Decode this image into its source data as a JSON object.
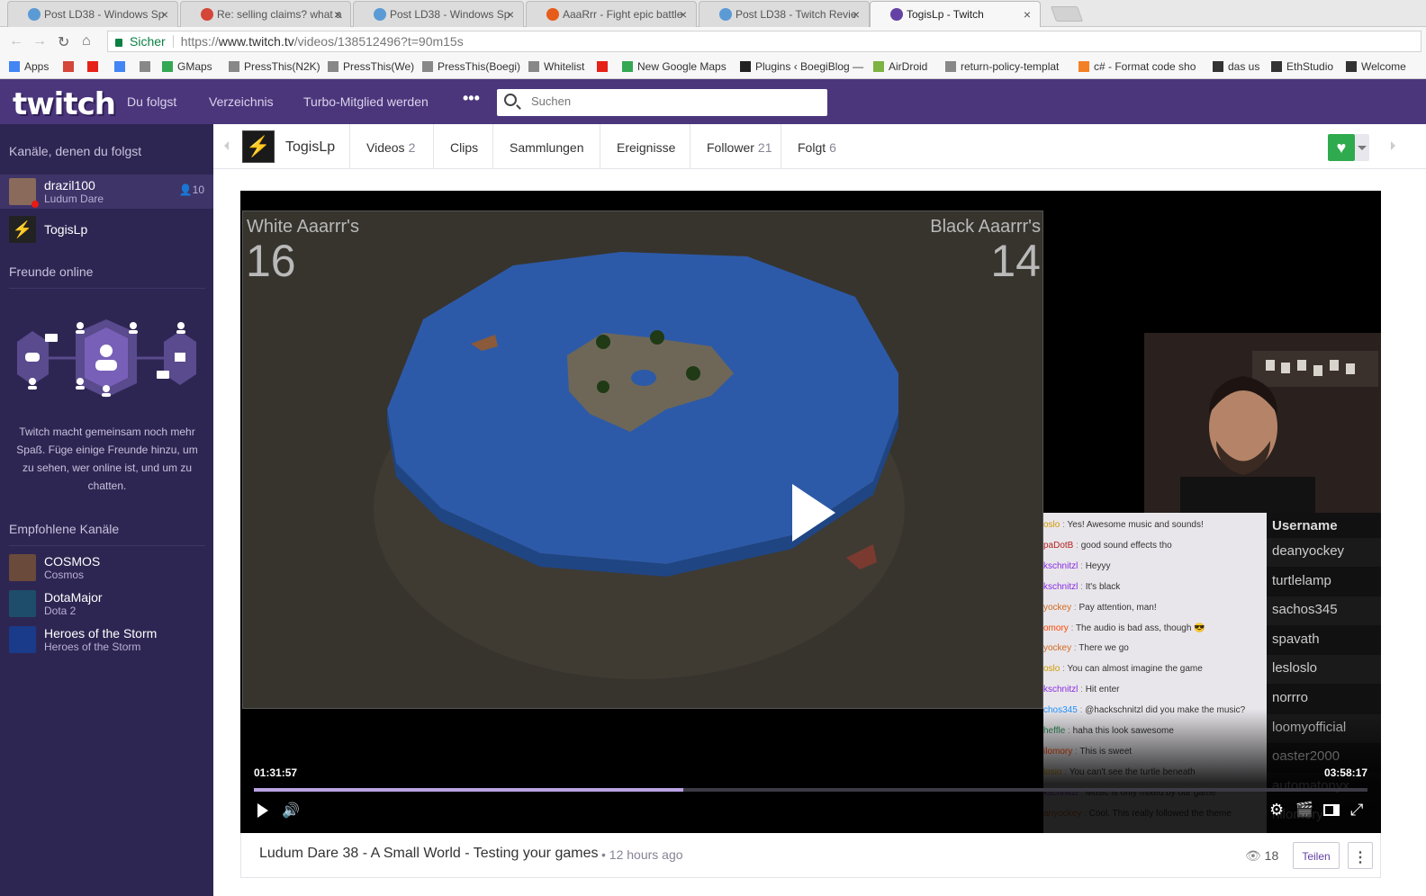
{
  "tabs": [
    {
      "title": "Post LD38 - Windows Sp",
      "active": false,
      "color": "#5b9bd5"
    },
    {
      "title": "Re: selling claims? what a",
      "active": false,
      "color": "#d44638"
    },
    {
      "title": "Post LD38 - Windows Sp",
      "active": false,
      "color": "#5b9bd5"
    },
    {
      "title": "AaaRrr - Fight epic battle",
      "active": false,
      "color": "#e65c1a"
    },
    {
      "title": "Post LD38 - Twitch Revie",
      "active": false,
      "color": "#5b9bd5"
    },
    {
      "title": "TogisLp - Twitch",
      "active": true,
      "color": "#6441a4"
    }
  ],
  "address": {
    "secure_label": "Sicher",
    "url_prefix": "https://",
    "url_host": "www.twitch.tv",
    "url_path": "/videos/138512496?t=90m15s"
  },
  "bookmarks": [
    {
      "label": "Apps",
      "icon": "apps-icon",
      "color": "#4285f4"
    },
    {
      "label": "",
      "icon": "gmail-icon",
      "color": "#d44638"
    },
    {
      "label": "",
      "icon": "youtube-icon",
      "color": "#e62117"
    },
    {
      "label": "",
      "icon": "google-icon",
      "color": "#4285f4"
    },
    {
      "label": "",
      "icon": "page-icon",
      "color": "#888888"
    },
    {
      "label": "GMaps",
      "icon": "maps-icon",
      "color": "#34a853"
    },
    {
      "label": "PressThis(N2K)",
      "icon": "page-icon",
      "color": "#888888"
    },
    {
      "label": "PressThis(We)",
      "icon": "page-icon",
      "color": "#888888"
    },
    {
      "label": "PressThis(Boegi)",
      "icon": "page-icon",
      "color": "#888888"
    },
    {
      "label": "Whitelist",
      "icon": "page-icon",
      "color": "#888888"
    },
    {
      "label": "",
      "icon": "youtube-icon",
      "color": "#e62117"
    },
    {
      "label": "New Google Maps",
      "icon": "maps-icon",
      "color": "#34a853"
    },
    {
      "label": "Plugins ‹ BoegiBlog —",
      "icon": "plugin-icon",
      "color": "#222222"
    },
    {
      "label": "AirDroid",
      "icon": "airdroid-icon",
      "color": "#7cb342"
    },
    {
      "label": "return-policy-templat",
      "icon": "page-icon",
      "color": "#888888"
    },
    {
      "label": "c# - Format code sho",
      "icon": "stackoverflow-icon",
      "color": "#f48024"
    },
    {
      "label": "das us",
      "icon": "headphones-icon",
      "color": "#333333"
    },
    {
      "label": "EthStudio",
      "icon": "ethstudio-icon",
      "color": "#333333"
    },
    {
      "label": "Welcome",
      "icon": "film-icon",
      "color": "#333333"
    }
  ],
  "topnav": {
    "logo": "twitch",
    "links": [
      "Du folgst",
      "Verzeichnis",
      "Turbo-Mitglied werden"
    ],
    "search_placeholder": "Suchen",
    "bg_color": "#4b367c"
  },
  "sidebar": {
    "followed_heading": "Kanäle, denen du folgst",
    "followed": [
      {
        "name": "drazil100",
        "game": "Ludum Dare",
        "viewers": "10",
        "active": true
      },
      {
        "name": "TogisLp",
        "game": "",
        "viewers": "",
        "active": false
      }
    ],
    "friends_heading": "Freunde online",
    "friends_text": "Twitch macht gemeinsam noch mehr Spaß. Füge einige Freunde hinzu, um zu sehen, wer online ist, und um zu chatten.",
    "recommended_heading": "Empfohlene Kanäle",
    "recommended": [
      {
        "name": "COSMOS",
        "game": "Cosmos"
      },
      {
        "name": "DotaMajor",
        "game": "Dota 2"
      },
      {
        "name": "Heroes of the Storm",
        "game": "Heroes of the Storm"
      }
    ]
  },
  "channelbar": {
    "name": "TogisLp",
    "tabs": [
      {
        "label": "Videos",
        "count": "2"
      },
      {
        "label": "Clips",
        "count": ""
      },
      {
        "label": "Sammlungen",
        "count": ""
      },
      {
        "label": "Ereignisse",
        "count": ""
      },
      {
        "label": "Follower",
        "count": "21"
      },
      {
        "label": "Folgt",
        "count": "6"
      }
    ],
    "follow_color": "#2faa4e"
  },
  "player": {
    "score_left_label": "White Aaarrr's",
    "score_left": "16",
    "score_right_label": "Black Aaarrr's",
    "score_right": "14",
    "current_time": "01:31:57",
    "duration": "03:58:17",
    "progress": 0.386,
    "chat": [
      {
        "user": "oslo",
        "color": "#d19a00",
        "msg": "Yes! Awesome music and sounds!"
      },
      {
        "user": "paDotB",
        "color": "#b22222",
        "msg": "good sound effects tho"
      },
      {
        "user": "kschnitzl",
        "color": "#8a2be2",
        "msg": "Heyyy"
      },
      {
        "user": "kschnitzl",
        "color": "#8a2be2",
        "msg": "It's black"
      },
      {
        "user": "yockey",
        "color": "#d2691e",
        "msg": "Pay attention, man!"
      },
      {
        "user": "omory",
        "color": "#ff4500",
        "msg": "The audio is bad ass, though 😎"
      },
      {
        "user": "yockey",
        "color": "#d2691e",
        "msg": "There we go"
      },
      {
        "user": "oslo",
        "color": "#d19a00",
        "msg": "You can almost imagine the game"
      },
      {
        "user": "kschnitzl",
        "color": "#8a2be2",
        "msg": "Hit enter"
      },
      {
        "user": "chos345",
        "color": "#1e90ff",
        "msg": "@hackschnitzl did you make the music?"
      },
      {
        "user": "heffle",
        "color": "#2e8b57",
        "msg": "haha this look sawesome"
      },
      {
        "user": "ilomory",
        "color": "#ff4500",
        "msg": "This is sweet"
      },
      {
        "user": "losio",
        "color": "#d19a00",
        "msg": "You can't see the turtle beneath"
      },
      {
        "user": "kschnitzl",
        "color": "#8a2be2",
        "msg": "Music is only mixed by our game"
      },
      {
        "user": "anyockey",
        "color": "#d2691e",
        "msg": "Cool. This really followed the theme"
      }
    ],
    "userlist_heading": "Username",
    "users": [
      "deanyockey",
      "turtlelamp",
      "sachos345",
      "spavath",
      "lesloslo",
      "norrro",
      "loomyofficial",
      "oaster2000",
      "automatonyx",
      "hilomory"
    ]
  },
  "video": {
    "title": "Ludum Dare 38 - A Small World - Testing your games",
    "ago": "• 12 hours ago",
    "views": "18",
    "share_label": "Teilen"
  }
}
